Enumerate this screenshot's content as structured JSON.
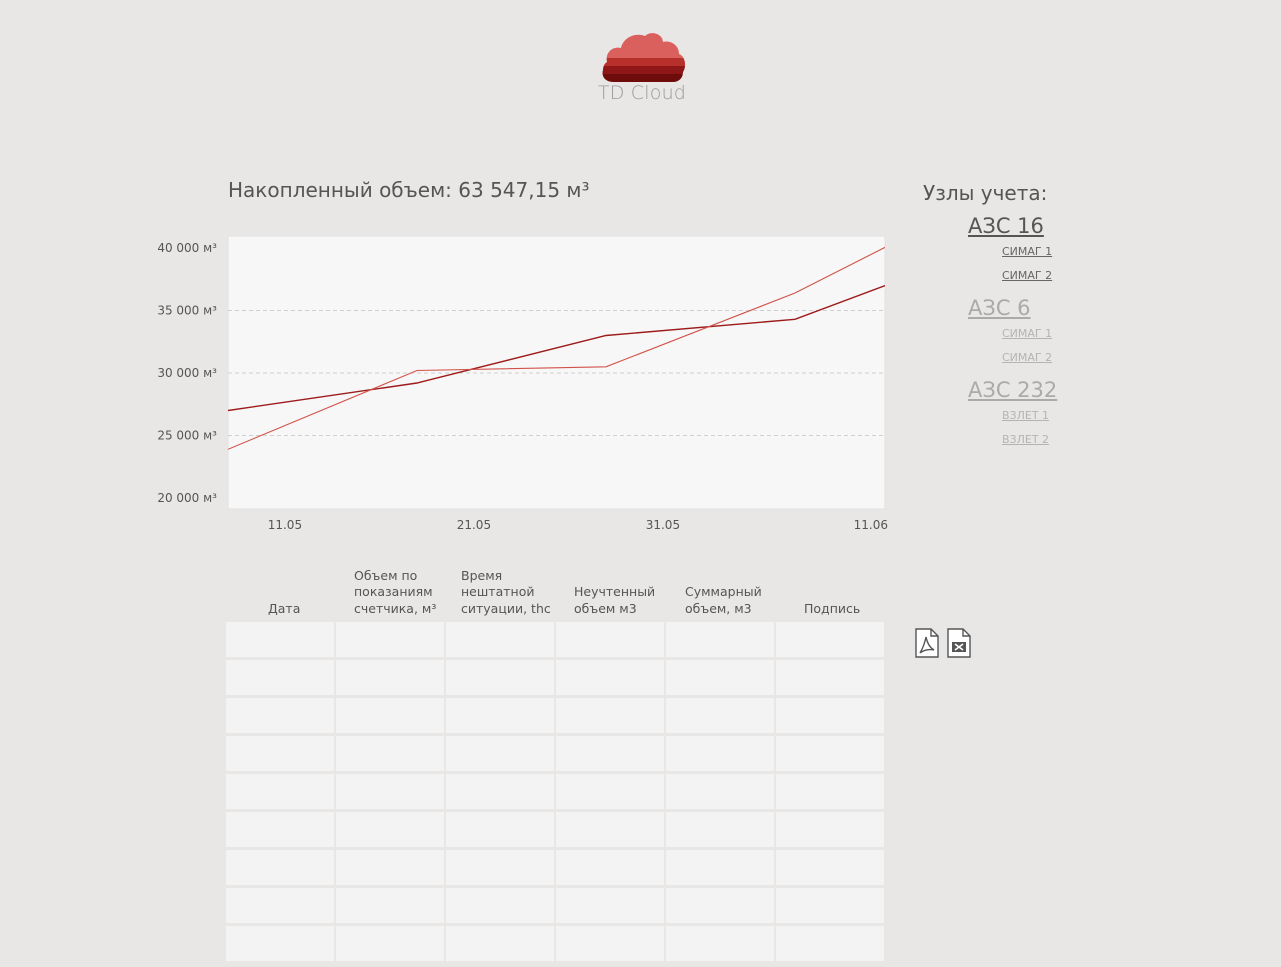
{
  "logo": {
    "text": "TD Cloud",
    "icon": "cloud-icon"
  },
  "header": {
    "total_volume": "Накопленный объем: 63 547,15 м³"
  },
  "colors": {
    "series_a": "#9e1b1b",
    "series_b": "#d2524a",
    "background": "#e8e7e5",
    "panel": "#f7f7f7"
  },
  "chart_data": {
    "type": "line",
    "title": "",
    "xlabel": "",
    "ylabel": "",
    "x_tick_labels": [
      "11.05",
      "21.05",
      "31.05",
      "11.06"
    ],
    "y_tick_labels": [
      "40 000 м³",
      "35 000 м³",
      "30 000 м³",
      "25 000 м³",
      "20 000 м³"
    ],
    "ylim": [
      20000,
      40000
    ],
    "grid": "horizontal dashed",
    "x": [
      "10.05",
      "20.05",
      "30.05",
      "09.06",
      "15.06"
    ],
    "series": [
      {
        "values": [
          27000,
          29200,
          33000,
          34300,
          37700
        ]
      },
      {
        "values": [
          23900,
          30200,
          30500,
          36400,
          41000
        ]
      }
    ]
  },
  "nodes": {
    "title": "Узлы учета:",
    "stations": [
      {
        "name": "АЗС 16",
        "active": true,
        "meters": [
          "СИМАГ 1",
          "СИМАГ 2"
        ]
      },
      {
        "name": "АЗС 6",
        "active": false,
        "meters": [
          "СИМАГ 1",
          "СИМАГ 2"
        ]
      },
      {
        "name": "АЗС 232",
        "active": false,
        "meters": [
          "ВЗЛЕТ 1",
          "ВЗЛЕТ 2"
        ]
      }
    ]
  },
  "table": {
    "columns": [
      "Дата",
      "Объем по показаниям счетчика, м³",
      "Время нештатной ситуации, thc",
      "Неучтенный объем м3",
      "Суммарный объем, м3",
      "Подпись"
    ],
    "row_count": 9
  },
  "export": {
    "pdf_icon": "pdf-icon",
    "excel_icon": "excel-icon"
  }
}
